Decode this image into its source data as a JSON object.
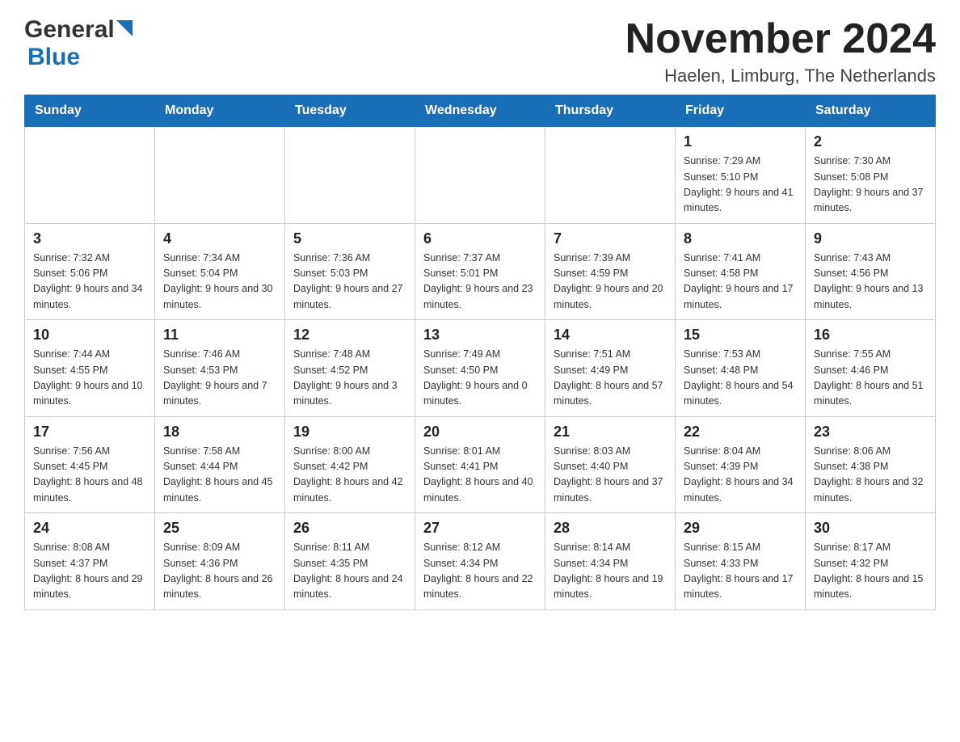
{
  "header": {
    "logo_general": "General",
    "logo_blue": "Blue",
    "month_title": "November 2024",
    "location": "Haelen, Limburg, The Netherlands"
  },
  "days_of_week": [
    "Sunday",
    "Monday",
    "Tuesday",
    "Wednesday",
    "Thursday",
    "Friday",
    "Saturday"
  ],
  "weeks": [
    [
      {
        "day": "",
        "info": ""
      },
      {
        "day": "",
        "info": ""
      },
      {
        "day": "",
        "info": ""
      },
      {
        "day": "",
        "info": ""
      },
      {
        "day": "",
        "info": ""
      },
      {
        "day": "1",
        "info": "Sunrise: 7:29 AM\nSunset: 5:10 PM\nDaylight: 9 hours and 41 minutes."
      },
      {
        "day": "2",
        "info": "Sunrise: 7:30 AM\nSunset: 5:08 PM\nDaylight: 9 hours and 37 minutes."
      }
    ],
    [
      {
        "day": "3",
        "info": "Sunrise: 7:32 AM\nSunset: 5:06 PM\nDaylight: 9 hours and 34 minutes."
      },
      {
        "day": "4",
        "info": "Sunrise: 7:34 AM\nSunset: 5:04 PM\nDaylight: 9 hours and 30 minutes."
      },
      {
        "day": "5",
        "info": "Sunrise: 7:36 AM\nSunset: 5:03 PM\nDaylight: 9 hours and 27 minutes."
      },
      {
        "day": "6",
        "info": "Sunrise: 7:37 AM\nSunset: 5:01 PM\nDaylight: 9 hours and 23 minutes."
      },
      {
        "day": "7",
        "info": "Sunrise: 7:39 AM\nSunset: 4:59 PM\nDaylight: 9 hours and 20 minutes."
      },
      {
        "day": "8",
        "info": "Sunrise: 7:41 AM\nSunset: 4:58 PM\nDaylight: 9 hours and 17 minutes."
      },
      {
        "day": "9",
        "info": "Sunrise: 7:43 AM\nSunset: 4:56 PM\nDaylight: 9 hours and 13 minutes."
      }
    ],
    [
      {
        "day": "10",
        "info": "Sunrise: 7:44 AM\nSunset: 4:55 PM\nDaylight: 9 hours and 10 minutes."
      },
      {
        "day": "11",
        "info": "Sunrise: 7:46 AM\nSunset: 4:53 PM\nDaylight: 9 hours and 7 minutes."
      },
      {
        "day": "12",
        "info": "Sunrise: 7:48 AM\nSunset: 4:52 PM\nDaylight: 9 hours and 3 minutes."
      },
      {
        "day": "13",
        "info": "Sunrise: 7:49 AM\nSunset: 4:50 PM\nDaylight: 9 hours and 0 minutes."
      },
      {
        "day": "14",
        "info": "Sunrise: 7:51 AM\nSunset: 4:49 PM\nDaylight: 8 hours and 57 minutes."
      },
      {
        "day": "15",
        "info": "Sunrise: 7:53 AM\nSunset: 4:48 PM\nDaylight: 8 hours and 54 minutes."
      },
      {
        "day": "16",
        "info": "Sunrise: 7:55 AM\nSunset: 4:46 PM\nDaylight: 8 hours and 51 minutes."
      }
    ],
    [
      {
        "day": "17",
        "info": "Sunrise: 7:56 AM\nSunset: 4:45 PM\nDaylight: 8 hours and 48 minutes."
      },
      {
        "day": "18",
        "info": "Sunrise: 7:58 AM\nSunset: 4:44 PM\nDaylight: 8 hours and 45 minutes."
      },
      {
        "day": "19",
        "info": "Sunrise: 8:00 AM\nSunset: 4:42 PM\nDaylight: 8 hours and 42 minutes."
      },
      {
        "day": "20",
        "info": "Sunrise: 8:01 AM\nSunset: 4:41 PM\nDaylight: 8 hours and 40 minutes."
      },
      {
        "day": "21",
        "info": "Sunrise: 8:03 AM\nSunset: 4:40 PM\nDaylight: 8 hours and 37 minutes."
      },
      {
        "day": "22",
        "info": "Sunrise: 8:04 AM\nSunset: 4:39 PM\nDaylight: 8 hours and 34 minutes."
      },
      {
        "day": "23",
        "info": "Sunrise: 8:06 AM\nSunset: 4:38 PM\nDaylight: 8 hours and 32 minutes."
      }
    ],
    [
      {
        "day": "24",
        "info": "Sunrise: 8:08 AM\nSunset: 4:37 PM\nDaylight: 8 hours and 29 minutes."
      },
      {
        "day": "25",
        "info": "Sunrise: 8:09 AM\nSunset: 4:36 PM\nDaylight: 8 hours and 26 minutes."
      },
      {
        "day": "26",
        "info": "Sunrise: 8:11 AM\nSunset: 4:35 PM\nDaylight: 8 hours and 24 minutes."
      },
      {
        "day": "27",
        "info": "Sunrise: 8:12 AM\nSunset: 4:34 PM\nDaylight: 8 hours and 22 minutes."
      },
      {
        "day": "28",
        "info": "Sunrise: 8:14 AM\nSunset: 4:34 PM\nDaylight: 8 hours and 19 minutes."
      },
      {
        "day": "29",
        "info": "Sunrise: 8:15 AM\nSunset: 4:33 PM\nDaylight: 8 hours and 17 minutes."
      },
      {
        "day": "30",
        "info": "Sunrise: 8:17 AM\nSunset: 4:32 PM\nDaylight: 8 hours and 15 minutes."
      }
    ]
  ]
}
